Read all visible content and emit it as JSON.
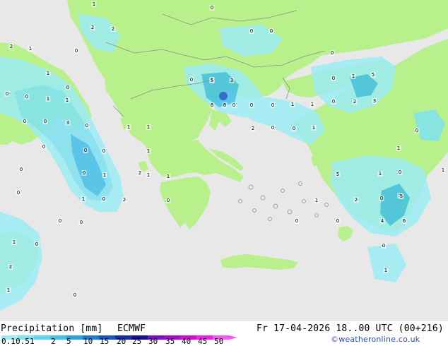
{
  "title": "Precipitation [mm]",
  "model": "ECMWF",
  "valid_time": "Fr 17-04-2026 18..00 UTC (00+216)",
  "credit": "©weatheronline.co.uk",
  "legend": {
    "ticks": [
      "0.1",
      "0.5",
      "1",
      "2",
      "5",
      "10",
      "15",
      "20",
      "25",
      "30",
      "35",
      "40",
      "45",
      "50"
    ],
    "colors": [
      "#9cecf5",
      "#7fe2f0",
      "#60d4ec",
      "#42c0e6",
      "#2aa2dd",
      "#1c7ecf",
      "#1856c1",
      "#1530a8",
      "#111390",
      "#7a10c8",
      "#a80ad0",
      "#d40bd8",
      "#ee20e8",
      "#f45af2"
    ]
  },
  "colors": {
    "sea": "#e8e8e8",
    "land": "#b8f08c",
    "border": "#8c8c8c"
  },
  "map_values": [
    {
      "v": "1"
    },
    {
      "v": "0"
    },
    {
      "v": "2"
    },
    {
      "v": "2"
    },
    {
      "v": "0"
    },
    {
      "v": "0"
    },
    {
      "v": "0"
    },
    {
      "v": "2"
    },
    {
      "v": "1"
    },
    {
      "v": "0"
    },
    {
      "v": "0"
    },
    {
      "v": "0"
    },
    {
      "v": "1"
    },
    {
      "v": "0"
    },
    {
      "v": "1"
    },
    {
      "v": "1"
    },
    {
      "v": "0"
    },
    {
      "v": "1"
    },
    {
      "v": "3"
    },
    {
      "v": "0"
    },
    {
      "v": "0"
    },
    {
      "v": "5"
    },
    {
      "v": "8"
    },
    {
      "v": "8"
    },
    {
      "v": "0"
    },
    {
      "v": "0"
    },
    {
      "v": "0"
    },
    {
      "v": "1"
    },
    {
      "v": "1"
    },
    {
      "v": "0"
    },
    {
      "v": "1"
    },
    {
      "v": "5"
    },
    {
      "v": "0"
    },
    {
      "v": "2"
    },
    {
      "v": "3"
    },
    {
      "v": "0"
    },
    {
      "v": "0"
    },
    {
      "v": "2"
    },
    {
      "v": "0"
    },
    {
      "v": "1"
    },
    {
      "v": "0"
    },
    {
      "v": "3"
    },
    {
      "v": "1"
    },
    {
      "v": "1"
    },
    {
      "v": "0"
    },
    {
      "v": "0"
    },
    {
      "v": "0"
    },
    {
      "v": "1"
    },
    {
      "v": "0"
    },
    {
      "v": "0"
    },
    {
      "v": "1"
    },
    {
      "v": "2"
    },
    {
      "v": "1"
    },
    {
      "v": "1"
    },
    {
      "v": "5"
    },
    {
      "v": "1"
    },
    {
      "v": "0"
    },
    {
      "v": "1"
    },
    {
      "v": "0"
    },
    {
      "v": "1"
    },
    {
      "v": "0"
    },
    {
      "v": "2"
    },
    {
      "v": "5"
    },
    {
      "v": "0"
    },
    {
      "v": "0"
    },
    {
      "v": "0"
    },
    {
      "v": "0"
    },
    {
      "v": "1"
    },
    {
      "v": "2"
    },
    {
      "v": "0"
    },
    {
      "v": "0"
    },
    {
      "v": "0"
    },
    {
      "v": "0"
    },
    {
      "v": "0"
    },
    {
      "v": "0"
    },
    {
      "v": "1"
    },
    {
      "v": "0"
    },
    {
      "v": "0"
    },
    {
      "v": "0"
    },
    {
      "v": "5"
    },
    {
      "v": "0"
    },
    {
      "v": "4"
    },
    {
      "v": "6"
    },
    {
      "v": "0"
    },
    {
      "v": "1"
    },
    {
      "v": "1"
    },
    {
      "v": "2"
    },
    {
      "v": "1"
    },
    {
      "v": "0"
    },
    {
      "v": "0"
    }
  ]
}
